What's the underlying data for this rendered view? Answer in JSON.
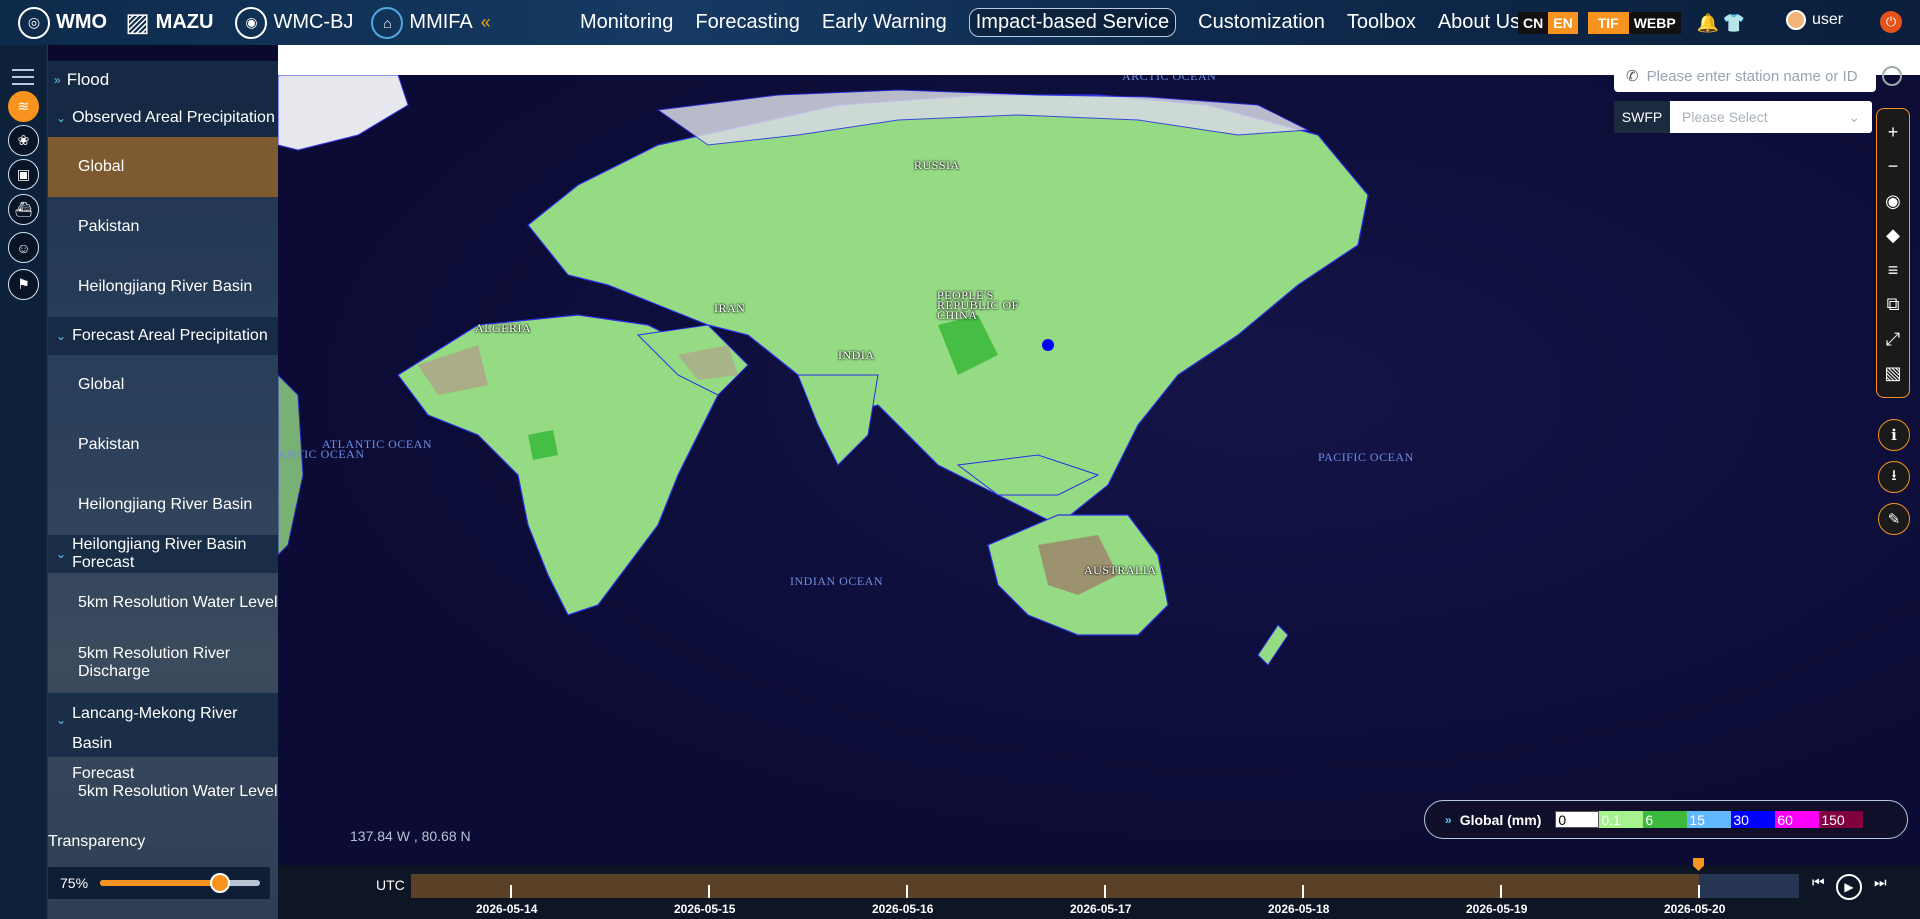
{
  "header": {
    "logos": [
      "WMO",
      "MAZU",
      "WMC-BJ",
      "MMIFA"
    ],
    "nav": [
      "Monitoring",
      "Forecasting",
      "Early Warning",
      "Impact-based Service",
      "Customization",
      "Toolbox",
      "About Us"
    ],
    "active_nav": "Impact-based Service",
    "lang": [
      "CN",
      "EN"
    ],
    "format": [
      "TIF",
      "WEBP"
    ],
    "user": "user"
  },
  "sidebar": {
    "root": "Flood",
    "sections": [
      {
        "title": "Observed Areal Precipitation",
        "items": [
          "Global",
          "Pakistan",
          "Heilongjiang River Basin"
        ]
      },
      {
        "title": "Forecast Areal Precipitation",
        "items": [
          "Global",
          "Pakistan",
          "Heilongjiang River Basin"
        ]
      },
      {
        "title": "Heilongjiang River Basin Forecast",
        "items": [
          "5km Resolution Water Level",
          "5km Resolution River Discharge"
        ]
      },
      {
        "title_line1": "Lancang-Mekong River Basin",
        "title_line2": "Forecast",
        "items": [
          "5km Resolution Water Level"
        ]
      }
    ],
    "selected": "Global",
    "transparency_label": "Transparency",
    "transparency_value": "75%",
    "transparency_level": 0.75
  },
  "map": {
    "labels": {
      "arctic": "ARCTIC OCEAN",
      "atlantic": "ATLANTIC OCEAN",
      "atlantic_left": "ANTIC OCEAN",
      "pacific": "PACIFIC OCEAN",
      "indian": "INDIAN OCEAN",
      "russia": "RUSSIA",
      "china_1": "PEOPLE'S",
      "china_2": "REPUBLIC OF",
      "china_3": "CHINA",
      "iran": "IRAN",
      "india": "INDIA",
      "algeria": "ALGERIA",
      "australia": "AUSTRALIA"
    },
    "coordinates": "137.84 W ,   80.68 N",
    "search_placeholder": "Please enter station name or ID",
    "swfp_label": "SWFP",
    "swfp_placeholder": "Please Select"
  },
  "legend": {
    "title": "Global (mm)",
    "stops": [
      {
        "label": "0",
        "color": "#ffffff"
      },
      {
        "label": "0.1",
        "color": "#a6f28f"
      },
      {
        "label": "6",
        "color": "#3dba3d"
      },
      {
        "label": "15",
        "color": "#61b8ff"
      },
      {
        "label": "30",
        "color": "#0000ff"
      },
      {
        "label": "60",
        "color": "#fa00fa"
      },
      {
        "label": "150",
        "color": "#800040"
      }
    ]
  },
  "timeline": {
    "utc_label": "UTC",
    "dates": [
      "2026-05-14",
      "2026-05-15",
      "2026-05-16",
      "2026-05-17",
      "2026-05-18",
      "2026-05-19",
      "2026-05-20"
    ]
  },
  "colors": {
    "accent": "#f7931e",
    "selected_item": "#7d5a2f"
  }
}
